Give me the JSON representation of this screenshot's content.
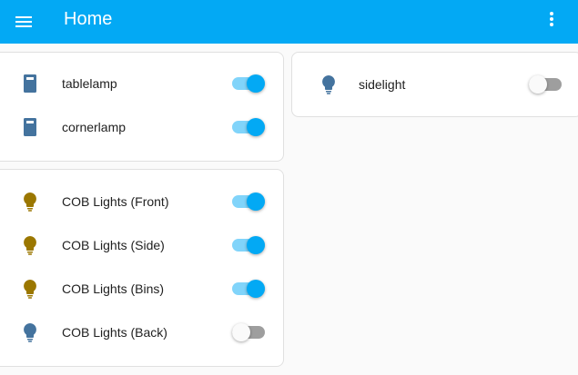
{
  "header": {
    "title": "Home"
  },
  "colors": {
    "accent": "#03a9f4",
    "bulb_on": "#9b7700",
    "bulb_off": "#44739e"
  },
  "cards": [
    {
      "items": [
        {
          "label": "tablelamp",
          "icon": "outlet-icon",
          "on": true
        },
        {
          "label": "cornerlamp",
          "icon": "outlet-icon",
          "on": true
        }
      ]
    },
    {
      "items": [
        {
          "label": "COB Lights (Front)",
          "icon": "lightbulb-icon",
          "on": true
        },
        {
          "label": "COB Lights (Side)",
          "icon": "lightbulb-icon",
          "on": true
        },
        {
          "label": "COB Lights (Bins)",
          "icon": "lightbulb-icon",
          "on": true
        },
        {
          "label": "COB Lights (Back)",
          "icon": "lightbulb-icon",
          "on": false
        }
      ]
    },
    {
      "items": [
        {
          "label": "sidelight",
          "icon": "lightbulb-icon",
          "on": false
        }
      ]
    }
  ]
}
